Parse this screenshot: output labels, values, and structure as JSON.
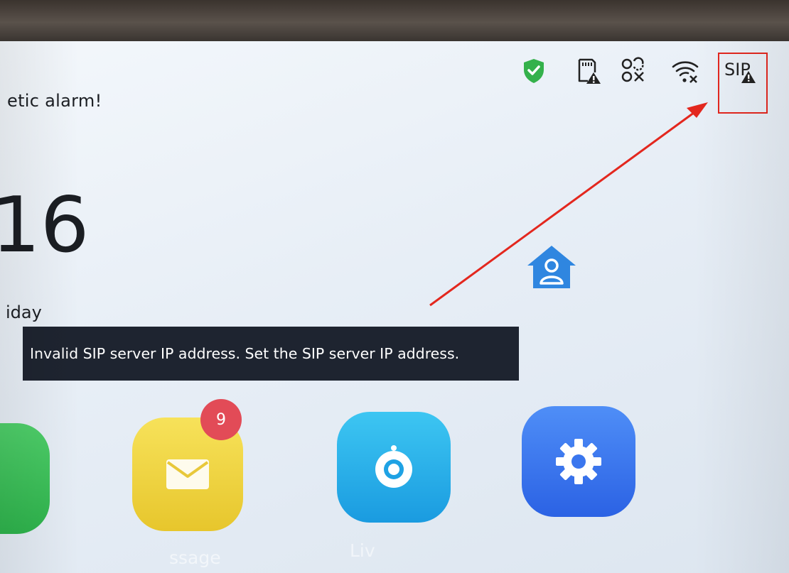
{
  "alarm_text": "etic alarm!",
  "date_fragment": "16",
  "day_fragment": "iday",
  "toast_message": "Invalid SIP server IP address. Set the SIP server IP address.",
  "status_bar": {
    "icons": [
      "shield-check-icon",
      "sd-card-warning-icon",
      "network-disconnected-icon",
      "wifi-disconnected-icon",
      "sip-warning-icon"
    ],
    "sip_label": "SIP"
  },
  "apps": {
    "message": {
      "badge_count": "9",
      "label": "ssage"
    },
    "live": {
      "label": "Liv"
    }
  },
  "colors": {
    "annotation_red": "#e3271e",
    "shield_green": "#34b14b",
    "toast_bg": "#1e2430"
  }
}
